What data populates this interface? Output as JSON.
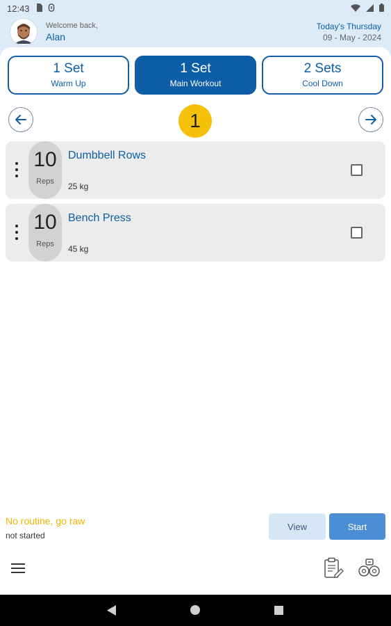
{
  "status_bar": {
    "time": "12:43",
    "icons": [
      "sim-card-icon",
      "sync-icon",
      "wifi-icon",
      "signal-icon",
      "battery-icon"
    ]
  },
  "header": {
    "welcome": "Welcome back,",
    "username": "Alan",
    "day": "Today's Thursday",
    "date": "09 - May - 2024"
  },
  "tabs": [
    {
      "sets": "1 Set",
      "label": "Warm Up",
      "active": false
    },
    {
      "sets": "1 Set",
      "label": "Main Workout",
      "active": true
    },
    {
      "sets": "2 Sets",
      "label": "Cool Down",
      "active": false
    }
  ],
  "set_nav": {
    "current": "1"
  },
  "exercises": [
    {
      "reps": "10",
      "reps_label": "Reps",
      "name": "Dumbbell Rows",
      "weight": "25 kg",
      "checked": false
    },
    {
      "reps": "10",
      "reps_label": "Reps",
      "name": "Bench Press",
      "weight": "45 kg",
      "checked": false
    }
  ],
  "routine": {
    "title": "No routine, go raw",
    "status": "not started"
  },
  "actions": {
    "view_label": "View",
    "start_label": "Start"
  },
  "colors": {
    "primary": "#0d5ea6",
    "accent": "#f6c10a",
    "start_button": "#4c8ed3",
    "view_button": "#d6e6f4",
    "header_bg": "#dcebf7"
  }
}
